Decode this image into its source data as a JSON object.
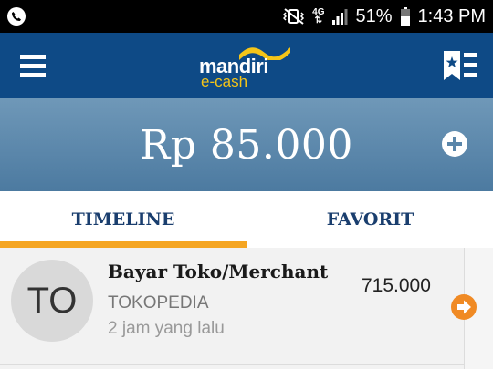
{
  "status_bar": {
    "app_icon": "phone-handset-icon",
    "network": "4G",
    "battery": "51%",
    "time": "1:43 PM"
  },
  "app_bar": {
    "menu_icon": "hamburger-menu-icon",
    "logo": {
      "brand": "mandiri",
      "sub": "e-cash"
    },
    "bookmark_icon": "bookmark-list-icon",
    "color": "#0e4a86"
  },
  "balance": {
    "amount": "Rp 85.000",
    "add_icon": "plus-circle-icon"
  },
  "tabs": [
    {
      "label": "TIMELINE",
      "active": true
    },
    {
      "label": "FAVORIT",
      "active": false
    }
  ],
  "accent_color": "#f5a623",
  "transactions": [
    {
      "avatar_text": "TO",
      "title": "Bayar Toko/Merchant",
      "merchant": "TOKOPEDIA",
      "time": "2 jam yang lalu",
      "amount": "715.000",
      "action_icon": "arrow-right-circle-icon"
    }
  ]
}
